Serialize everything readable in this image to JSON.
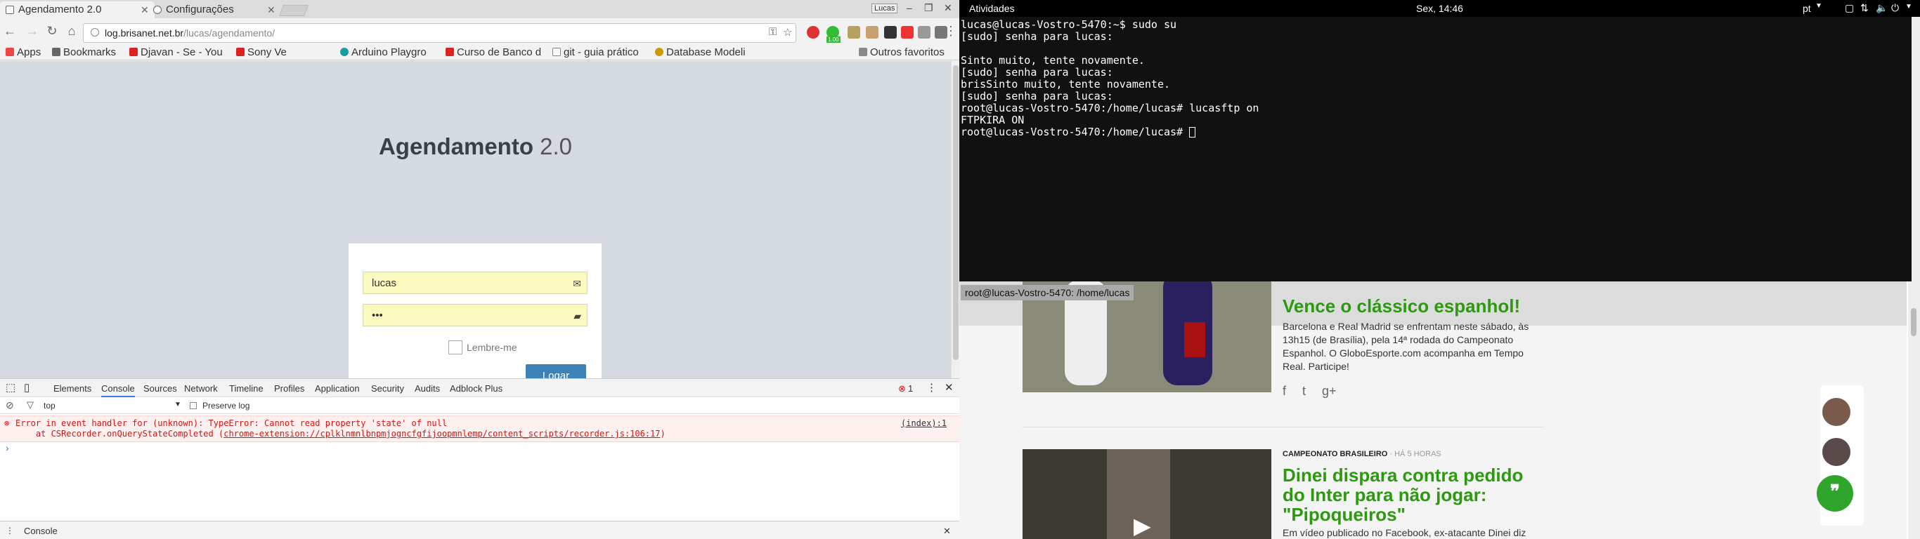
{
  "browser": {
    "tabs": [
      {
        "label": "Agendamento 2.0"
      },
      {
        "label": "Configurações"
      }
    ],
    "window_badge": "Lucas",
    "url_host": "log.brisanet.net.br",
    "url_path": "/lucas/agendamento/",
    "bookmarks": [
      "Apps",
      "Bookmarks",
      "Djavan - Se - You",
      "Sony Ve",
      "Arduino Playgro",
      "Curso de Banco d",
      "git - guia prático",
      "Database Modeli"
    ],
    "other_bookmarks": "Outros favoritos",
    "ext_badge": "1.00"
  },
  "login": {
    "title": "Agendamento",
    "version": "2.0",
    "username": "lucas",
    "password_mask": "•••",
    "remember": "Lembre-me",
    "submit": "Logar"
  },
  "devtools": {
    "tabs": [
      "Elements",
      "Console",
      "Sources",
      "Network",
      "Timeline",
      "Profiles",
      "Application",
      "Security",
      "Audits",
      "Adblock Plus"
    ],
    "error_count": "1",
    "context": "top",
    "preserve_log": "Preserve log",
    "error_line1": "Error in event handler for (unknown): TypeError: Cannot read property 'state' of null",
    "error_line2_prefix": "    at CSRecorder.onQueryStateCompleted (",
    "error_link": "chrome-extension://cplklnmnlbnpmjogncfgfijoopmnlemp/content_scripts/recorder.js:106:17",
    "error_line2_suffix": ")",
    "error_source": "(index):1",
    "prompt": "›",
    "drawer_tab": "Console"
  },
  "desktop": {
    "activities": "Atividades",
    "clock": "Sex, 14:46",
    "lang": "pt"
  },
  "terminal": {
    "lines": [
      "lucas@lucas-Vostro-5470:~$ sudo su",
      "[sudo] senha para lucas:",
      "",
      "Sinto muito, tente novamente.",
      "[sudo] senha para lucas:",
      "brisSinto muito, tente novamente.",
      "[sudo] senha para lucas:",
      "root@lucas-Vostro-5470:/home/lucas# lucasftp on",
      "FTPKIRA ON",
      "root@lucas-Vostro-5470:/home/lucas# "
    ],
    "title": "root@lucas-Vostro-5470: /home/lucas"
  },
  "site": {
    "articles": [
      {
        "category": "",
        "age": "",
        "headline": "Vence o clássico espanhol!",
        "desc": "Barcelona e Real Madrid se enfrentam neste sábado, às 13h15 (de Brasília), pela 14ª rodada do Campeonato Espanhol. O GloboEsporte.com acompanha em Tempo Real. Participe!"
      },
      {
        "category": "CAMPEONATO BRASILEIRO",
        "age": "· HÁ 5 HORAS",
        "headline": "Dinei dispara contra pedido do Inter para não jogar: \"Pipoqueiros\"",
        "desc": "Em vídeo publicado no Facebook, ex-atacante Dinei diz que"
      }
    ]
  }
}
